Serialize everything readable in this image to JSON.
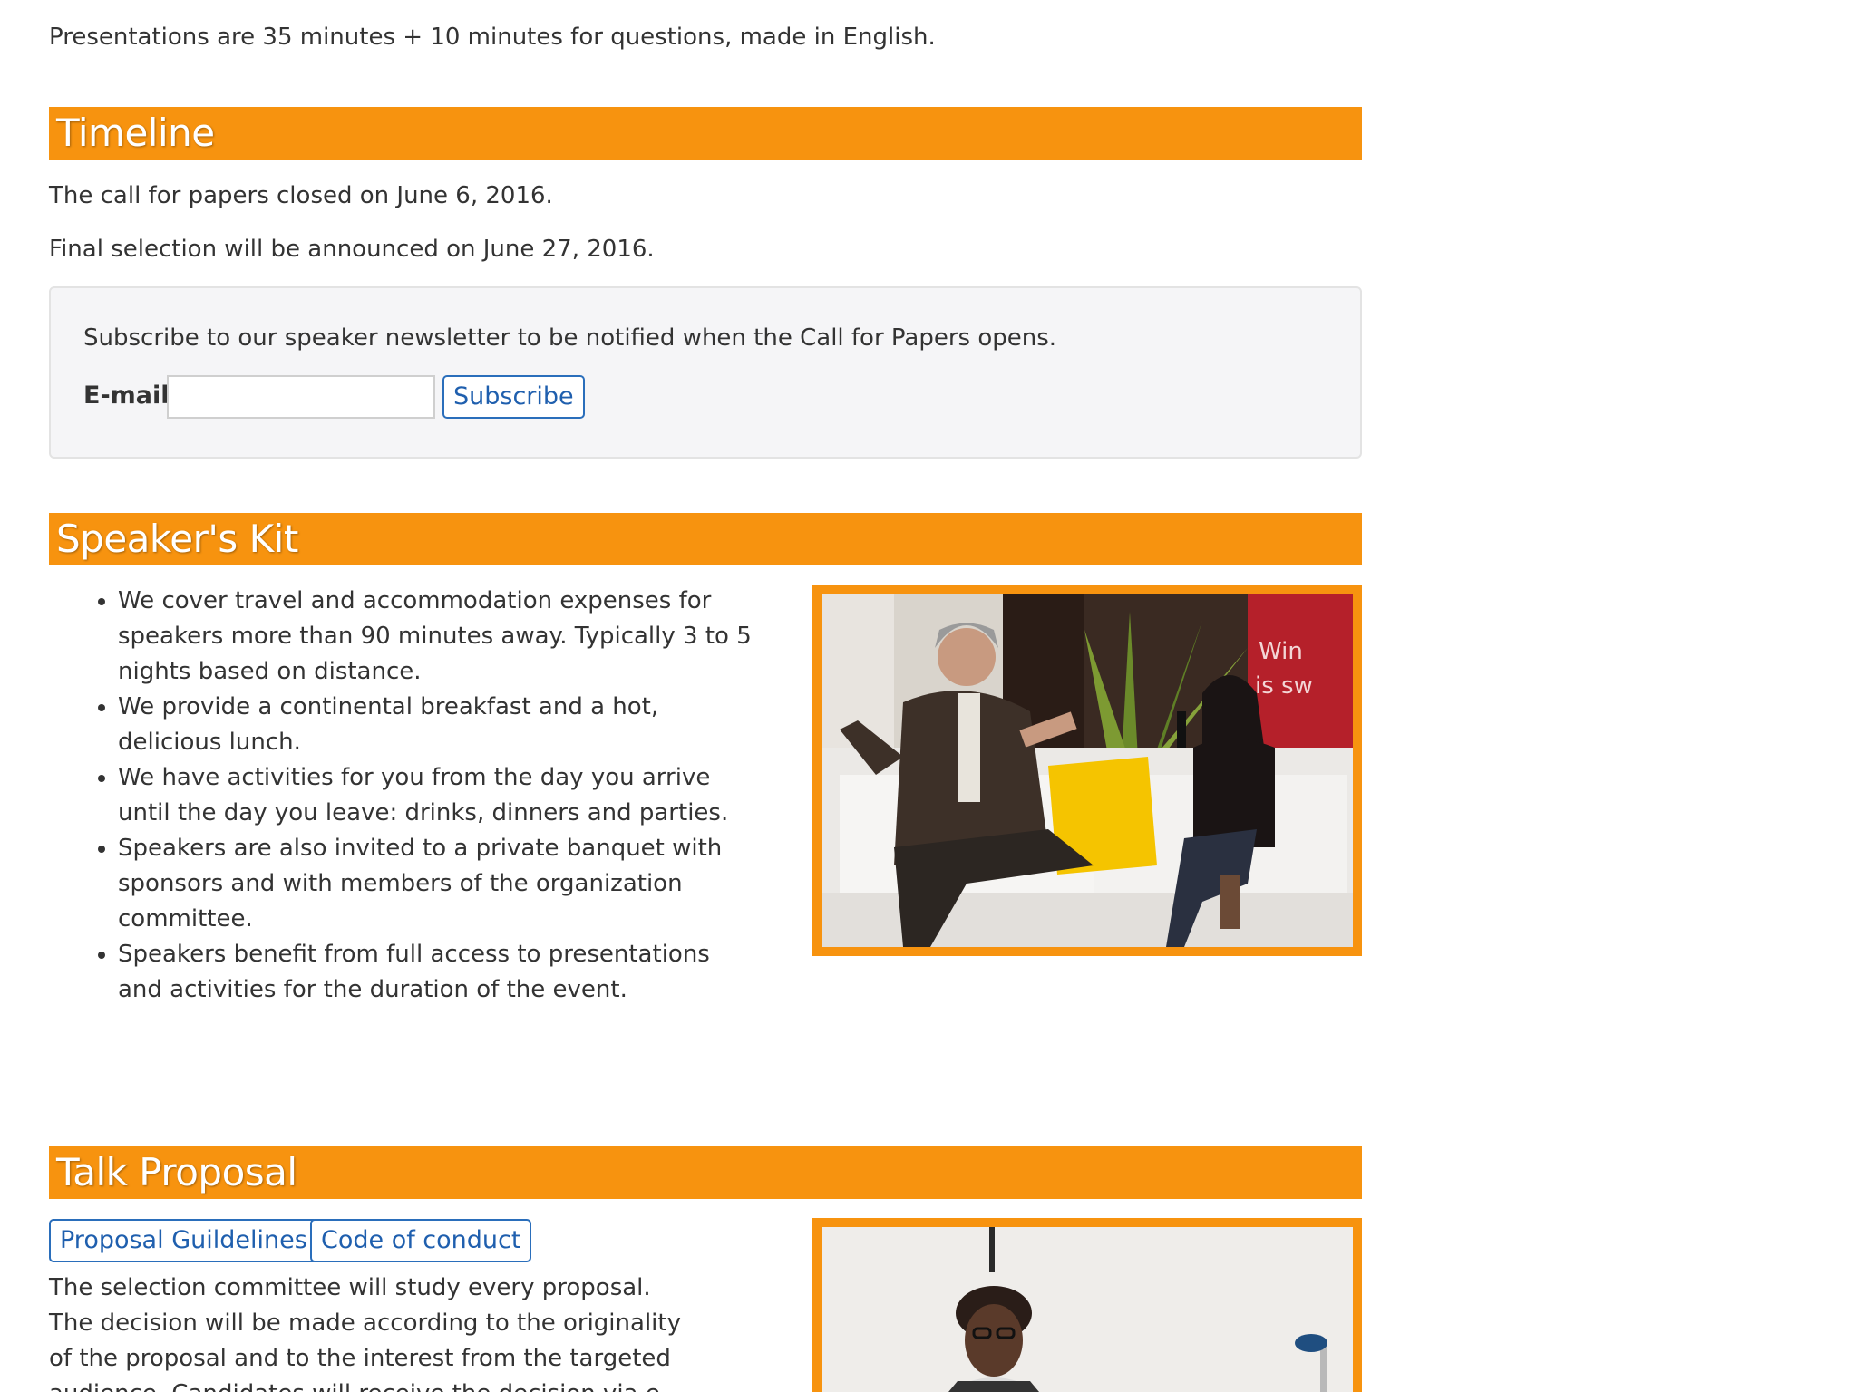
{
  "intro": {
    "text": "Presentations are 35 minutes + 10 minutes for questions, made in English."
  },
  "timeline": {
    "heading": "Timeline",
    "lines": [
      "The call for papers closed on June 6, 2016.",
      "Final selection will be announced on June 27, 2016."
    ],
    "subscribe": {
      "text": "Subscribe to our speaker newsletter to be notified when the Call for Papers opens.",
      "email_label": "E-mail",
      "email_value": "",
      "button_label": "Subscribe"
    }
  },
  "speakers_kit": {
    "heading": "Speaker's Kit",
    "items": [
      "We cover travel and accommodation expenses for speakers more than 90 minutes away. Typically 3 to 5 nights based on distance.",
      "We provide a continental breakfast and a hot, delicious lunch.",
      "We have activities for you from the day you arrive until the day you leave: drinks, dinners and parties.",
      "Speakers are also invited to a private banquet with sponsors and with members of the organization committee.",
      "Speakers benefit from full access to presentations and activities for the duration of the event."
    ],
    "photo_sign_text": [
      "Win",
      "is sw"
    ]
  },
  "talk_proposal": {
    "heading": "Talk Proposal",
    "buttons": {
      "guidelines": "Proposal Guildelines",
      "conduct": "Code of conduct"
    },
    "text": "The selection committee will study every proposal. The decision will be made according to the originality of the proposal and to the interest from the targeted audience. Candidates will receive the decision via e-"
  },
  "colors": {
    "accent": "#f7930f",
    "link": "#1f5fae",
    "text": "#333333"
  }
}
